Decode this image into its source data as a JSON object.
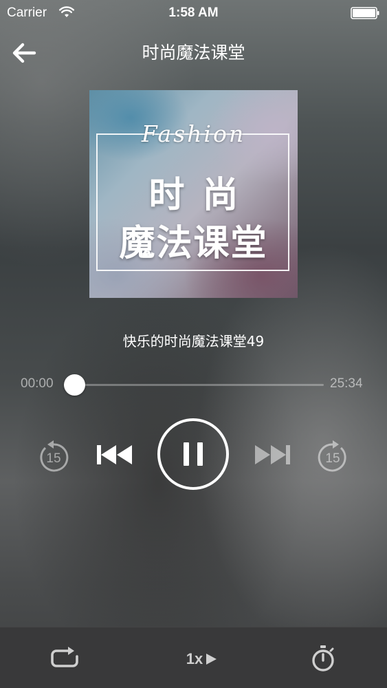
{
  "status_bar": {
    "carrier": "Carrier",
    "time": "1:58 AM"
  },
  "nav": {
    "title": "时尚魔法课堂"
  },
  "album_art": {
    "script_text": "Fashion",
    "line1": "时尚",
    "line2": "魔法课堂"
  },
  "track": {
    "title": "快乐的时尚魔法课堂49"
  },
  "progress": {
    "elapsed": "00:00",
    "total": "25:34",
    "fraction": 0.04
  },
  "controls": {
    "rewind_seconds": "15",
    "forward_seconds": "15",
    "state": "playing"
  },
  "toolbar": {
    "speed_label": "1x"
  },
  "icons": {
    "back": "arrow-left-icon",
    "wifi": "wifi-icon",
    "battery": "battery-icon",
    "rewind": "rewind-15-icon",
    "prev": "skip-previous-icon",
    "pause": "pause-icon",
    "next": "skip-next-icon",
    "forward": "forward-15-icon",
    "repeat": "repeat-icon",
    "speed": "play-triangle-icon",
    "timer": "timer-icon"
  },
  "colors": {
    "toolbar_bg": "#39393a",
    "accent": "#ffffff",
    "muted_text": "#a8a8a8"
  }
}
